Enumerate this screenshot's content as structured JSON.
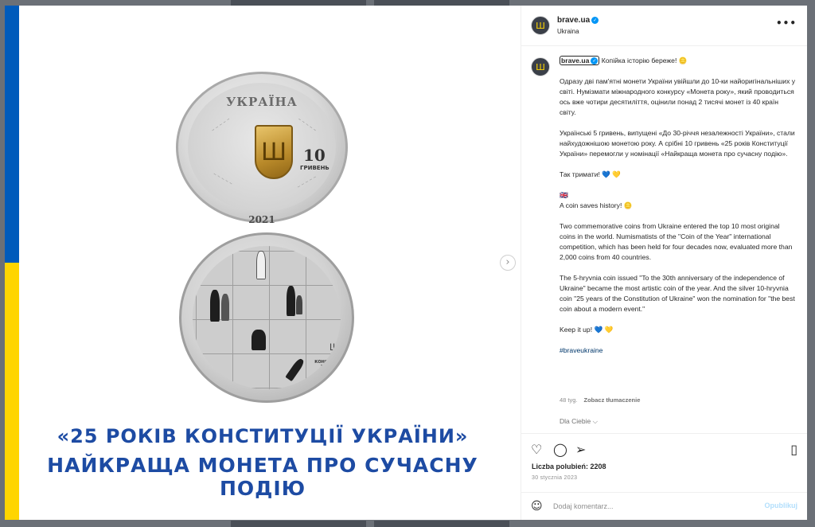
{
  "post": {
    "username": "brave.ua",
    "location": "Ukraina",
    "more_icon": "more-horizontal-icon",
    "verified_icon": "verified-badge-icon",
    "caption": {
      "p1": "Копійка історію береже! 🪙",
      "p2": "Одразу дві пам'ятні монети України увійшли до 10-ки найоригінальніших у світі. Нумізмати міжнародного конкурсу «Монета року», який проводиться ось вже чотири десятиліття, оцінили понад 2 тисячі монет із 40 країн світу.",
      "p3": "Українські 5 гривень, випущені «До 30-річчя незалежності України», стали найхудожнішою монетою року. А срібні 10 гривень «25 років Конституції України» перемогли у номінації «Найкраща монета про сучасну подію».",
      "p4": "Так тримати! 💙 💛",
      "p5a": "🇬🇧",
      "p5b": "A coin saves history! 🪙",
      "p6": "Two commemorative coins from Ukraine entered the top 10 most original coins in the world. Numismatists of the \"Coin of the Year\" international competition, which has been held for four decades now, evaluated more than 2,000 coins from 40 countries.",
      "p7": "The 5-hryvnia coin issued \"To the 30th anniversary of the independence of Ukraine\" became the most artistic coin of the year. And the silver 10-hryvnia coin \"25 years of the Constitution of Ukraine\" won the nomination for \"the best coin about a modern event.\"",
      "p8": "Keep it up! 💙 💛",
      "hashtag": "#braveukraine"
    },
    "age": "48 tyg.",
    "translate": "Zobacz tłumaczenie",
    "for_you": "Dla Ciebie",
    "likes": "Liczba polubień: 2208",
    "date": "30 stycznia 2023",
    "comment_placeholder": "Dodaj komentarz...",
    "publish": "Opublikuj"
  },
  "media": {
    "coin_top_title": "УКРАЇНА",
    "coin_top_value": "10",
    "coin_top_unit": "ГРИВЕНЬ",
    "coin_top_year": "2021",
    "coin_bottom_label": "КОНСТИТУЦІЯ УКРАЇНИ",
    "headline_line1": "«25 РОКІВ КОНСТИТУЦІЇ УКРАЇНИ»",
    "headline_line2": "НАЙКРАЩА МОНЕТА ПРО СУЧАСНУ ПОДІЮ",
    "trident_icon": "Ш"
  },
  "icons": {
    "like": "heart-icon",
    "comment": "comment-icon",
    "share": "share-icon",
    "save": "bookmark-icon",
    "emoji": "emoji-icon",
    "next": "chevron-right-icon"
  },
  "colors": {
    "flag_blue": "#005bbb",
    "flag_yellow": "#ffd500",
    "headline": "#1d4ba3",
    "verified": "#0095f6",
    "link": "#00376b"
  }
}
